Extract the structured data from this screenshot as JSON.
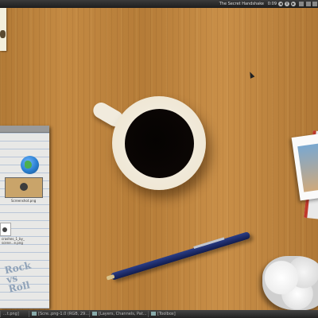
{
  "topbar": {
    "window_title": "The Secret Handshake",
    "time": "0:09",
    "controls": [
      "prev",
      "pause",
      "next",
      "stop"
    ]
  },
  "desktop": {
    "icons": [
      {
        "name": "globe-icon",
        "label": ""
      },
      {
        "name": "thumb-icon",
        "label": "Screenshot.png"
      },
      {
        "name": "doc-icon",
        "label": "crashes_1_by_\nscene...e.png"
      }
    ],
    "notepad_scribble": "Rock\nvs\nRoll"
  },
  "taskbar": {
    "tasks": [
      "...t.png]",
      "[Scre..png-1.0 (RGB, 29...",
      "[Layers, Channels, Pat...",
      "[Toolbox]"
    ]
  },
  "colors": {
    "wood": "#c48a43",
    "coffee": "#0b0604",
    "mug": "#f7f2e8",
    "pen": "#2c3e86",
    "topbar": "#2a2a2a"
  }
}
